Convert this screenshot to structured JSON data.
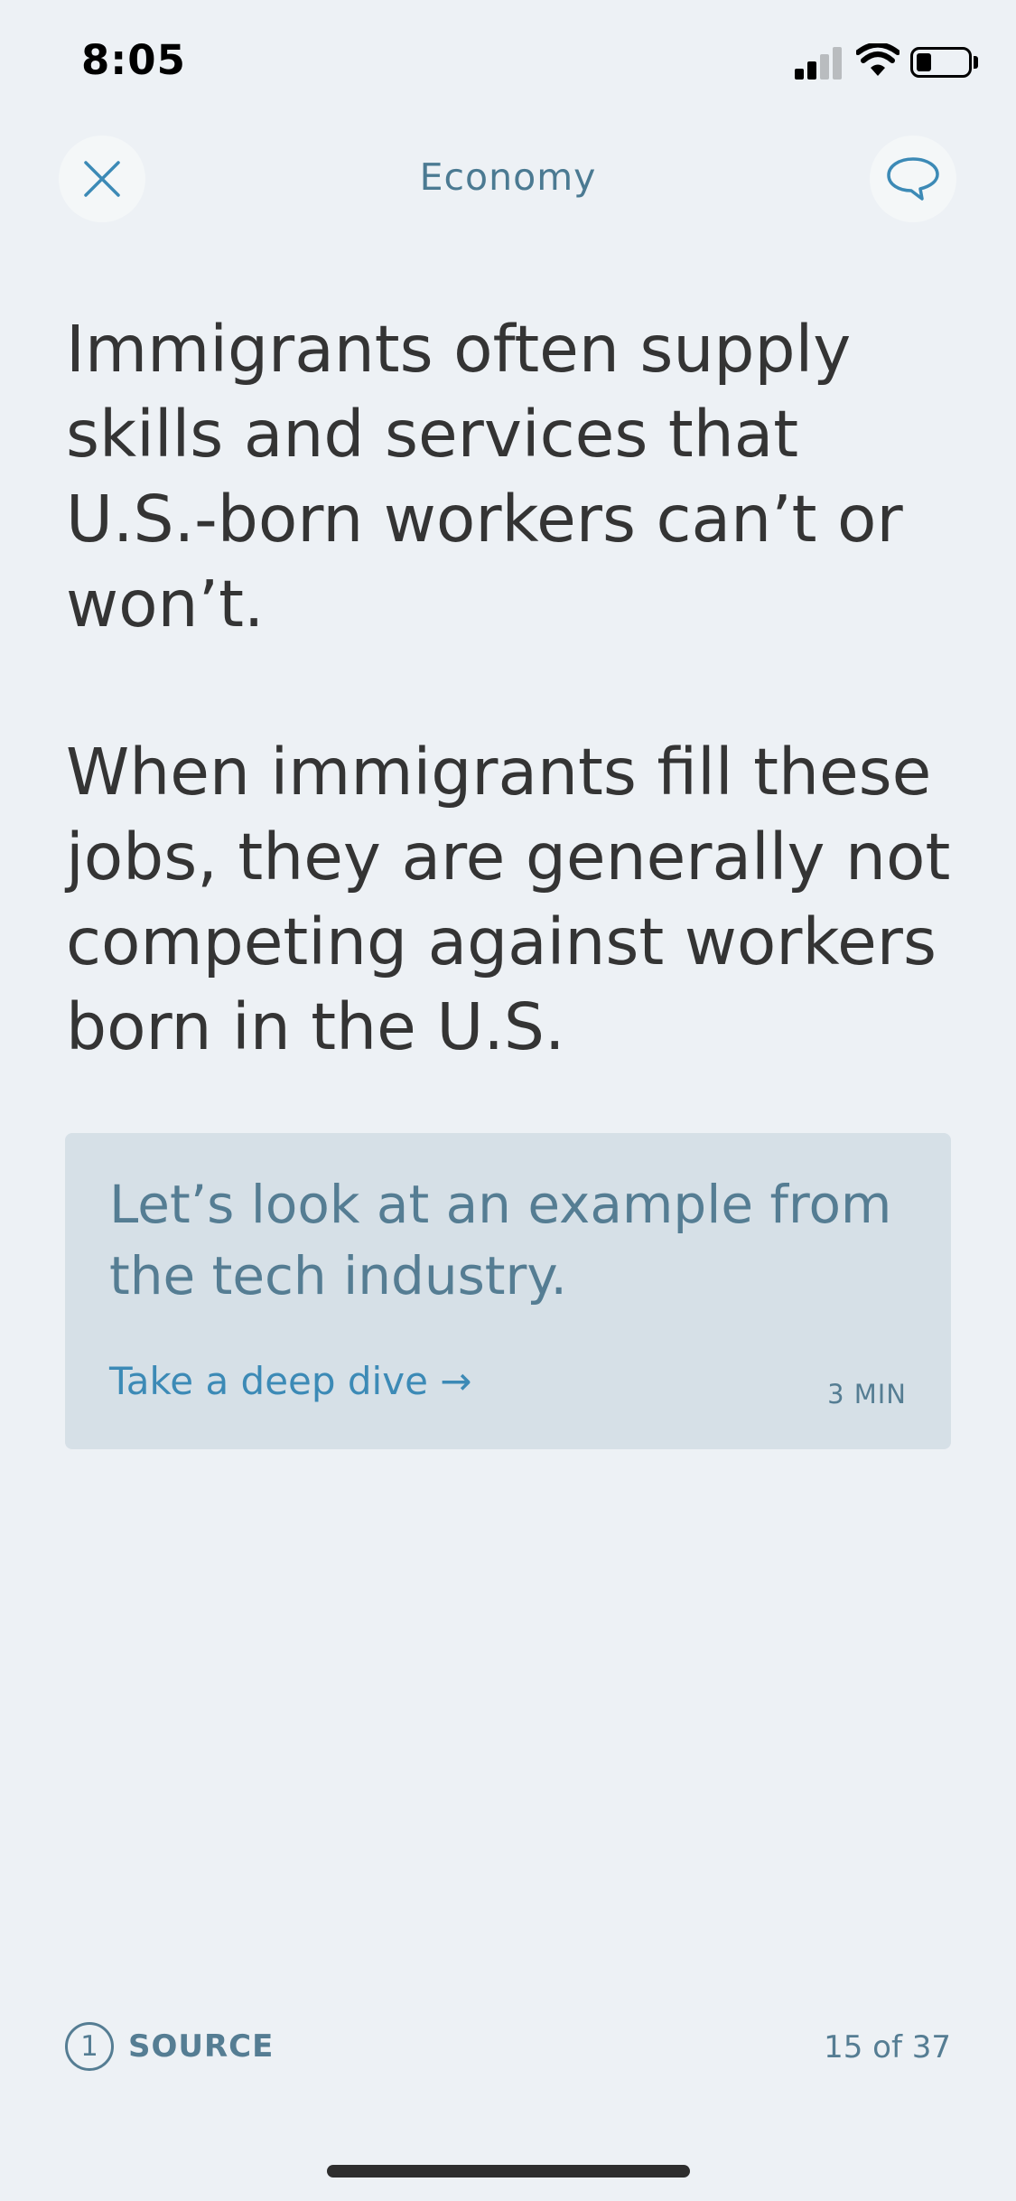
{
  "status_bar": {
    "time": "8:05",
    "icons": [
      "cellular-signal-icon",
      "wifi-icon",
      "battery-icon"
    ]
  },
  "header": {
    "title": "Economy",
    "left_icon": "close-icon",
    "right_icon": "chat-bubble-icon"
  },
  "content": {
    "paragraphs": [
      "Immigrants often supply skills and services that U.S.-born workers can’t or won’t.",
      "When immigrants fill these jobs, they are generally not competing against workers born in the U.S."
    ]
  },
  "deep_dive": {
    "text": "Let’s look at an example from the tech industry.",
    "link_label": "Take a deep dive →",
    "read_time": "3 MIN"
  },
  "footer": {
    "source_count": "1",
    "source_label": "SOURCE",
    "page_counter": "15 of 37"
  },
  "colors": {
    "background": "#edf1f5",
    "card": "#d6e0e7",
    "accent": "#3c8ab6",
    "muted": "#557d93",
    "body_text": "#343434"
  }
}
